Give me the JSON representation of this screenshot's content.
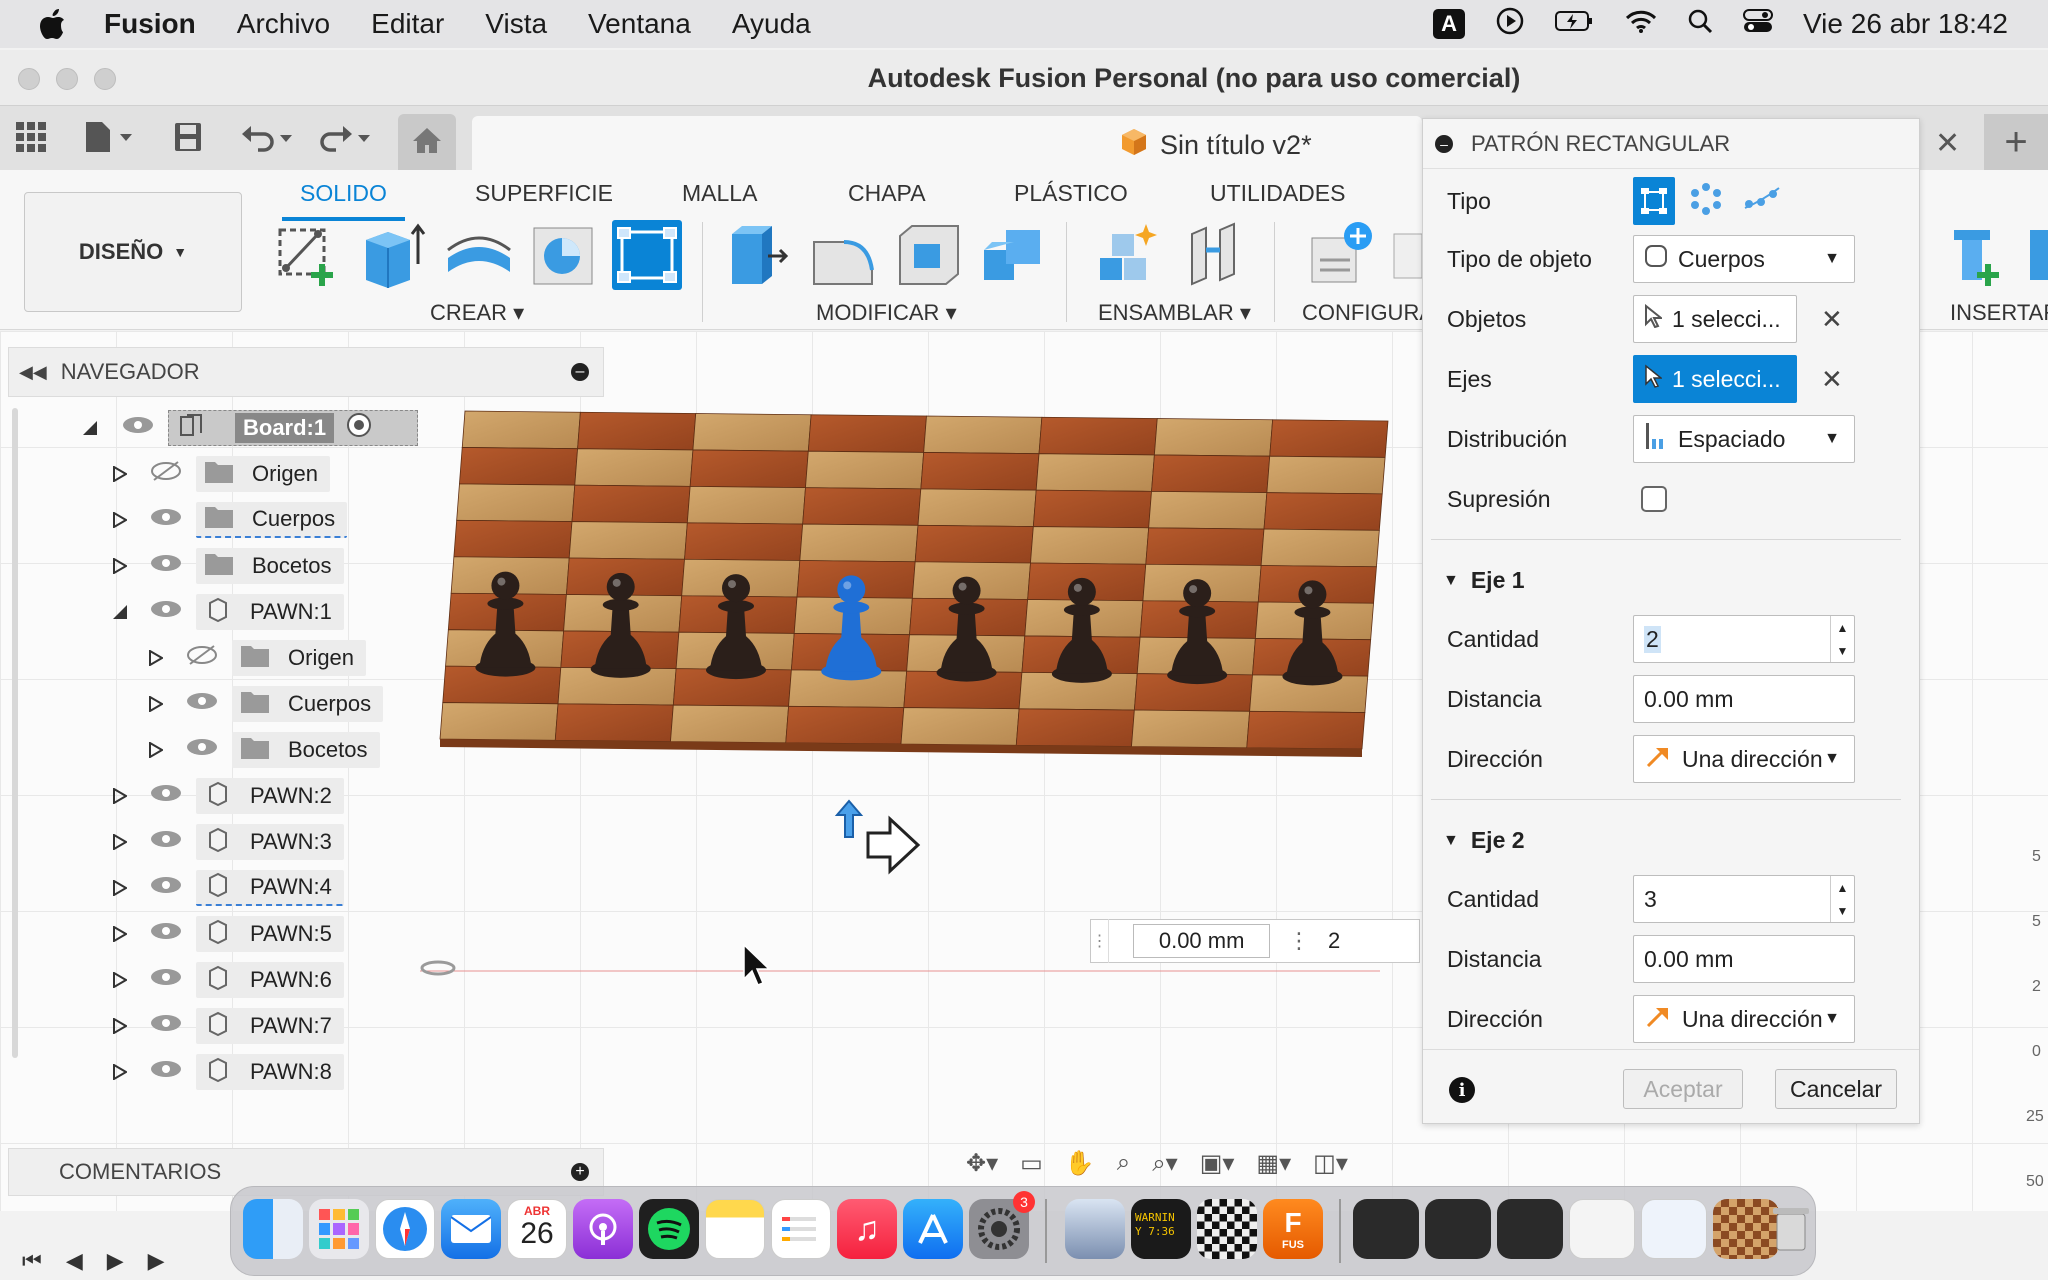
{
  "menubar": {
    "app": "Fusion",
    "items": [
      "Archivo",
      "Editar",
      "Vista",
      "Ventana",
      "Ayuda"
    ],
    "keyboard_badge": "A",
    "clock": "Vie 26 abr 18:42"
  },
  "window": {
    "title": "Autodesk Fusion Personal (no para uso comercial)"
  },
  "document": {
    "tab_name": "Sin título v2*"
  },
  "ribbon": {
    "workspace": "DISEÑO",
    "tabs": [
      "SOLIDO",
      "SUPERFICIE",
      "MALLA",
      "CHAPA",
      "PLÁSTICO",
      "UTILIDADES"
    ],
    "groups": {
      "crear": "CREAR",
      "modificar": "MODIFICAR",
      "ensamblar": "ENSAMBLAR",
      "configurar": "CONFIGURA",
      "insertar": "INSERTAR"
    }
  },
  "navigator": {
    "title": "NAVEGADOR",
    "root": "Board:1",
    "items": [
      {
        "label": "Origen"
      },
      {
        "label": "Cuerpos"
      },
      {
        "label": "Bocetos"
      },
      {
        "label": "PAWN:1"
      },
      {
        "label": "Origen"
      },
      {
        "label": "Cuerpos"
      },
      {
        "label": "Bocetos"
      },
      {
        "label": "PAWN:2"
      },
      {
        "label": "PAWN:3"
      },
      {
        "label": "PAWN:4"
      },
      {
        "label": "PAWN:5"
      },
      {
        "label": "PAWN:6"
      },
      {
        "label": "PAWN:7"
      },
      {
        "label": "PAWN:8"
      }
    ]
  },
  "comments": {
    "title": "COMENTARIOS"
  },
  "viewport": {
    "distance_input": "0.00 mm",
    "count_input": "2"
  },
  "dialog": {
    "title": "PATRÓN RECTANGULAR",
    "tipo_label": "Tipo",
    "tipo_objeto_label": "Tipo de objeto",
    "tipo_objeto_value": "Cuerpos",
    "objetos_label": "Objetos",
    "objetos_value": "1 selecci...",
    "ejes_label": "Ejes",
    "ejes_value": "1 selecci...",
    "distribucion_label": "Distribución",
    "distribucion_value": "Espaciado",
    "supresion_label": "Supresión",
    "eje1": {
      "title": "Eje 1",
      "cantidad_label": "Cantidad",
      "cantidad": "2",
      "distancia_label": "Distancia",
      "distancia": "0.00 mm",
      "direccion_label": "Dirección",
      "direccion": "Una dirección"
    },
    "eje2": {
      "title": "Eje 2",
      "cantidad_label": "Cantidad",
      "cantidad": "3",
      "distancia_label": "Distancia",
      "distancia": "0.00 mm",
      "direccion_label": "Dirección",
      "direccion": "Una dirección"
    },
    "accept": "Aceptar",
    "cancel": "Cancelar"
  },
  "dock": {
    "calendar_month": "ABR",
    "calendar_day": "26",
    "settings_badge": "3",
    "console_text": "WARNIN\nY 7:36",
    "fusion_label": "FUS"
  },
  "colors": {
    "accent": "#0a84d6",
    "board_dark": "#a8522a",
    "board_light": "#c79a62",
    "pawn_dark": "#2b1f1a",
    "pawn_selected": "#1f6fd6"
  }
}
